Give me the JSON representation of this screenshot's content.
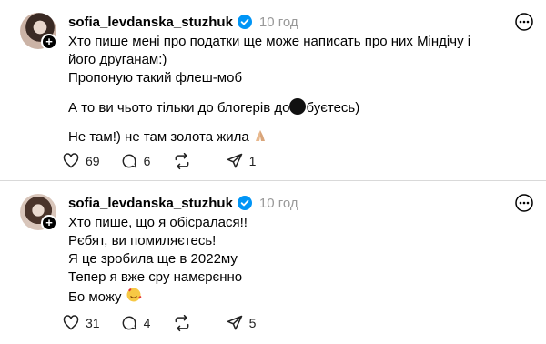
{
  "posts": [
    {
      "username": "sofia_levdanska_stuzhuk",
      "time": "10 год",
      "lines": [
        "Хто пише мені про податки ще може написать про них Міндічу і",
        "його друганам:)",
        "Пропоную такий флеш-моб",
        "А то ви чьото тільки до блогерів до",
        "буєтесь)",
        "Не там!) не там золота жила"
      ],
      "likes": "69",
      "comments": "6",
      "reposts": "",
      "shares": "1"
    },
    {
      "username": "sofia_levdanska_stuzhuk",
      "time": "10 год",
      "lines": [
        "Хто пише, що я обісралася!!",
        "Рєбят, ви помиляєтесь!",
        "Я це зробила ще в 2022му",
        "Тепер я вже сру намєрєнно",
        "Бо можу"
      ],
      "likes": "31",
      "comments": "4",
      "reposts": "",
      "shares": "5"
    }
  ],
  "icons": {
    "verified": "verified-badge-icon",
    "more": "more-options-icon",
    "like": "heart-icon",
    "comment": "comment-icon",
    "repost": "repost-icon",
    "share": "send-icon",
    "follow": "plus-icon"
  },
  "colors": {
    "verified": "#0095f6",
    "muted": "#999999",
    "divider": "#d9d9d9"
  }
}
